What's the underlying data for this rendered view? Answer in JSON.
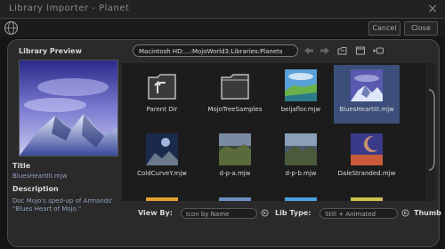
{
  "window": {
    "title": "Library Importer - Planet"
  },
  "toolbar": {
    "cancel_label": "Cancel",
    "close_label": "Close"
  },
  "preview": {
    "heading": "Library Preview",
    "title_label": "Title",
    "title_value": "BluesHeartIII.mjw",
    "description_label": "Description",
    "description_value": "Doc Mojo's sped-up of Armands' \"Blues Heart of Mojo.\""
  },
  "browser": {
    "path": "Macintosh HD:...:MojoWorld3:Libraries:Planets",
    "items": [
      {
        "label": "Parent Dir",
        "icon": "folder-up-icon",
        "selected": false
      },
      {
        "label": "MojoTreeSamples",
        "icon": "folder-icon",
        "selected": false
      },
      {
        "label": "beijaflor.mjw",
        "icon": "planet-thumbnail",
        "selected": false
      },
      {
        "label": "BluesHeartIII.mjw",
        "icon": "planet-thumbnail",
        "selected": true
      },
      {
        "label": "ColdCurveY.mjw",
        "icon": "planet-thumbnail",
        "selected": false
      },
      {
        "label": "d-p-a.mjw",
        "icon": "planet-thumbnail",
        "selected": false
      },
      {
        "label": "d-p-b.mjw",
        "icon": "planet-thumbnail",
        "selected": false
      },
      {
        "label": "DaleStranded.mjw",
        "icon": "planet-thumbnail",
        "selected": false
      },
      {
        "label": "",
        "icon": "planet-thumbnail",
        "selected": false
      },
      {
        "label": "",
        "icon": "planet-thumbnail",
        "selected": false
      },
      {
        "label": "",
        "icon": "planet-thumbnail",
        "selected": false
      },
      {
        "label": "",
        "icon": "planet-thumbnail",
        "selected": false
      }
    ]
  },
  "footer": {
    "view_by_label": "View By:",
    "view_by_value": "Icon by Name",
    "lib_type_label": "Lib Type:",
    "lib_type_value": "Still + Animated",
    "thumb_label": "Thumb"
  },
  "colors": {
    "selection": "#3b4f7a",
    "panel": "#2a2a2a",
    "path_text": "#8fa0bd"
  }
}
